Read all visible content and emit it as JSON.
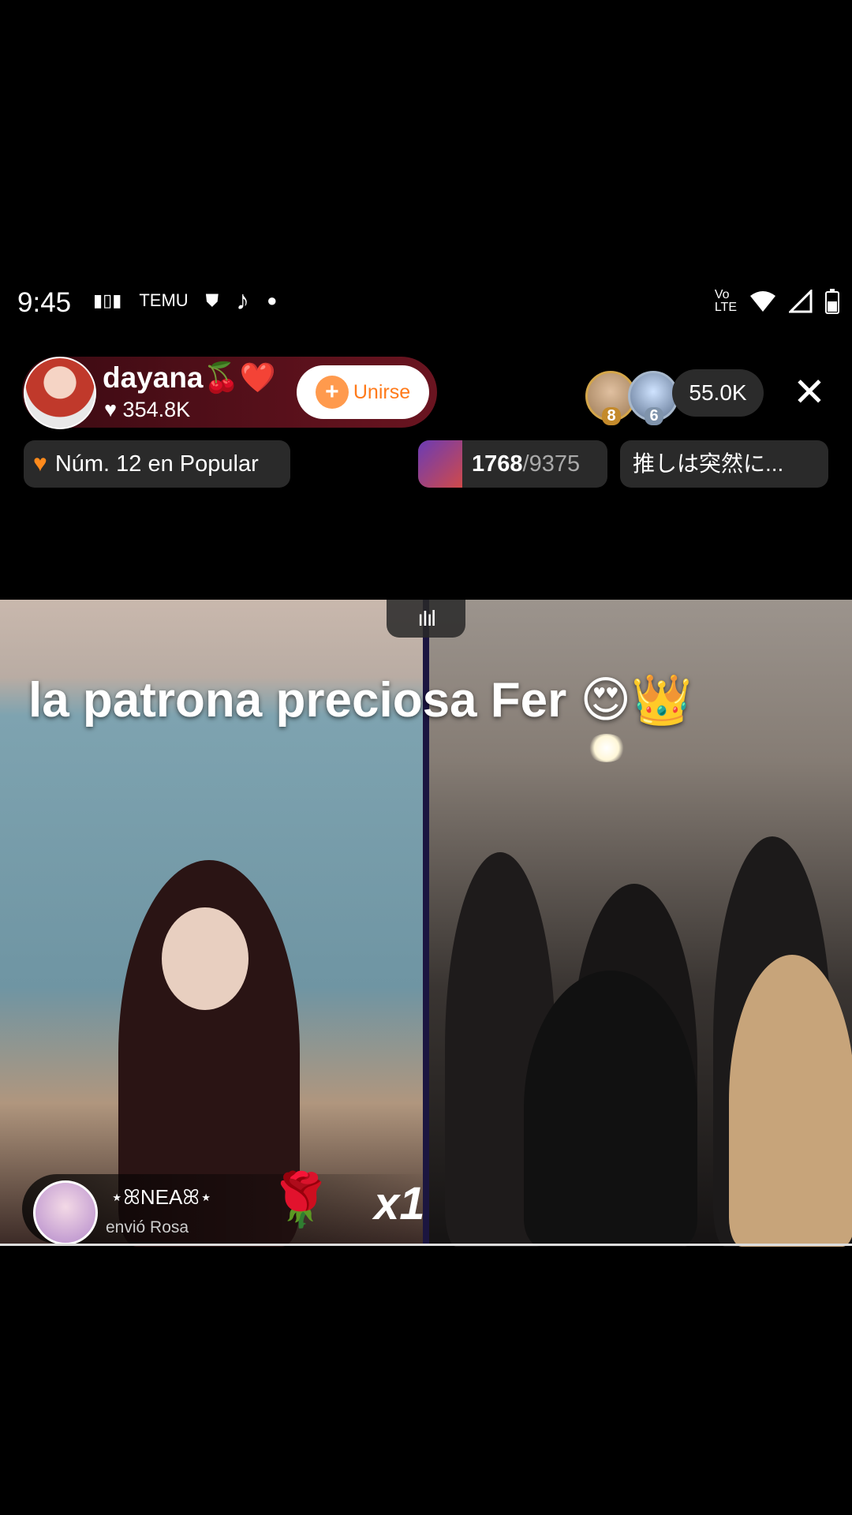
{
  "status_bar": {
    "time": "9:45",
    "left_icons": [
      "equalizer-icon",
      "temu-icon",
      "shield-icon",
      "tiktok-icon",
      "dot-icon"
    ],
    "right_icons": [
      "volte-icon",
      "wifi-icon",
      "signal-icon",
      "battery-icon"
    ]
  },
  "host": {
    "name": "dayana🍒❤️",
    "likes": "354.8K",
    "join_label": "Unirse"
  },
  "viewers": {
    "badges": [
      "8",
      "6"
    ],
    "count": "55.0K"
  },
  "rank": {
    "label": "Núm. 12 en Popular"
  },
  "goal": {
    "current": "1768",
    "separator": "/",
    "total": "9375"
  },
  "topic": "推しは突然に...",
  "stage_text": "la patrona preciosa Fer 😍👑",
  "gift": {
    "user": "⋆ꕤNEAꕤ⋆",
    "action": "envió Rosa",
    "icon": "🌹",
    "count": "x1"
  },
  "pull_tab": "ıIıl"
}
